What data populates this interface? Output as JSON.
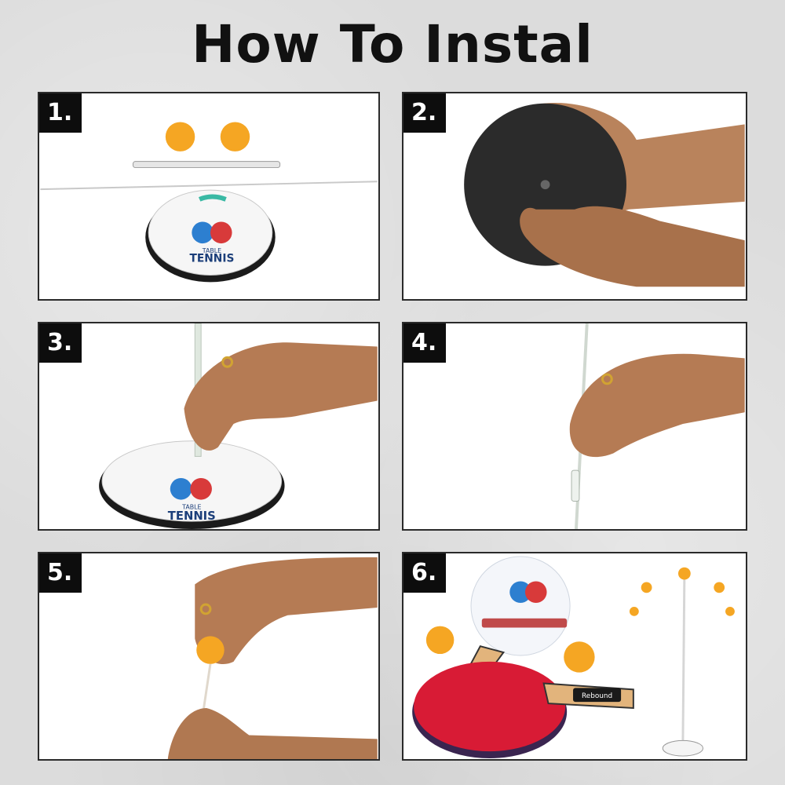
{
  "title": "How To Instal",
  "steps": [
    {
      "number": "1."
    },
    {
      "number": "2."
    },
    {
      "number": "3."
    },
    {
      "number": "4."
    },
    {
      "number": "5."
    },
    {
      "number": "6."
    }
  ],
  "base_label": {
    "line1": "TABLE",
    "line2": "TENNIS"
  },
  "paddle_brand": "Rebound",
  "colors": {
    "ball": "#f5a623",
    "panel_border": "#2a2a2a",
    "step_badge": "#0d0d0d",
    "paddle_red": "#d81b35",
    "skin": "#b9835c"
  }
}
